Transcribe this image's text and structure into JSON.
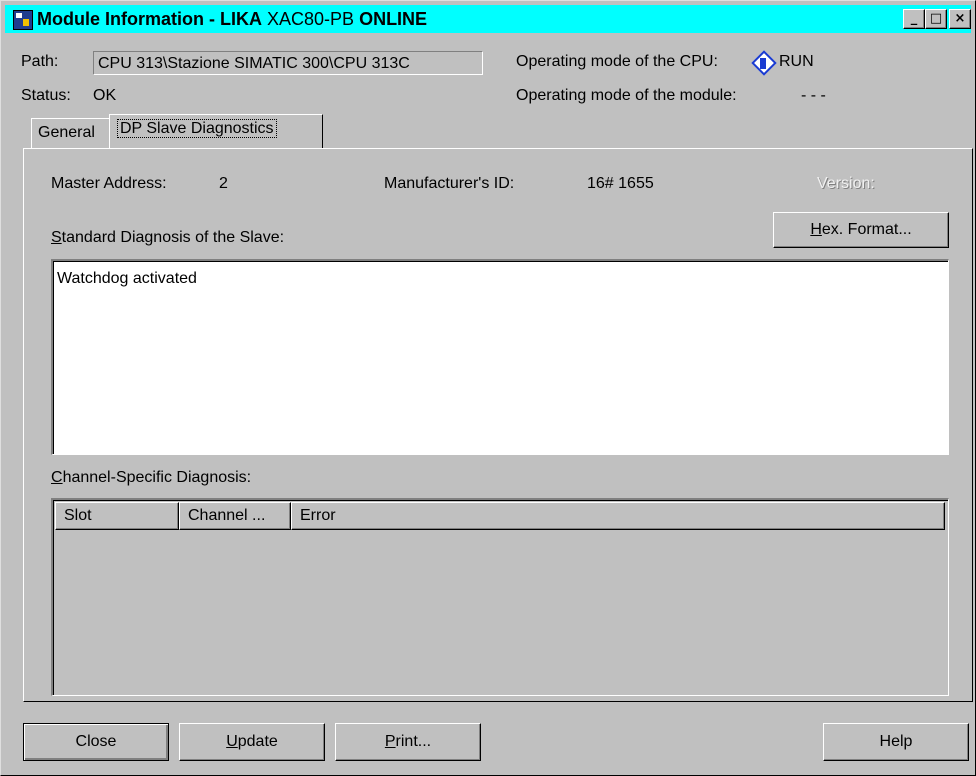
{
  "window": {
    "title_prefix": "Module Information - ",
    "title_module": "LIKA",
    "title_model": "XAC80-PB",
    "title_state": "ONLINE",
    "controls": {
      "minimize": "_",
      "maximize": "□",
      "close": "×"
    }
  },
  "header": {
    "path_label": "Path:",
    "path_value": "CPU 313\\Stazione SIMATIC 300\\CPU 313C",
    "status_label": "Status:",
    "status_value": "OK",
    "cpu_mode_label": "Operating mode of the  CPU:",
    "cpu_mode_value": "RUN",
    "module_mode_label": "Operating mode of the module:",
    "module_mode_value": "- - -"
  },
  "tabs": [
    {
      "label": "General",
      "active": false
    },
    {
      "label": "DP Slave Diagnostics",
      "active": true
    }
  ],
  "dp_slave": {
    "master_address_label": "Master Address:",
    "master_address_value": "2",
    "manufacturer_id_label": "Manufacturer's ID:",
    "manufacturer_id_value": "16# 1655",
    "version_label": "Version:",
    "hex_format_button": "Hex. Format...",
    "standard_diag_label": "Standard Diagnosis of the Slave:",
    "standard_diag_items": [
      "Watchdog activated"
    ],
    "channel_diag_label": "Channel-Specific Diagnosis:",
    "channel_columns": [
      "Slot",
      "Channel ...",
      "Error"
    ]
  },
  "buttons": {
    "close": "Close",
    "update": "Update",
    "print": "Print...",
    "help": "Help"
  },
  "colors": {
    "titlebar": "#00ffff",
    "face": "#c0c0c0",
    "run_icon": "#1a3bd1"
  }
}
